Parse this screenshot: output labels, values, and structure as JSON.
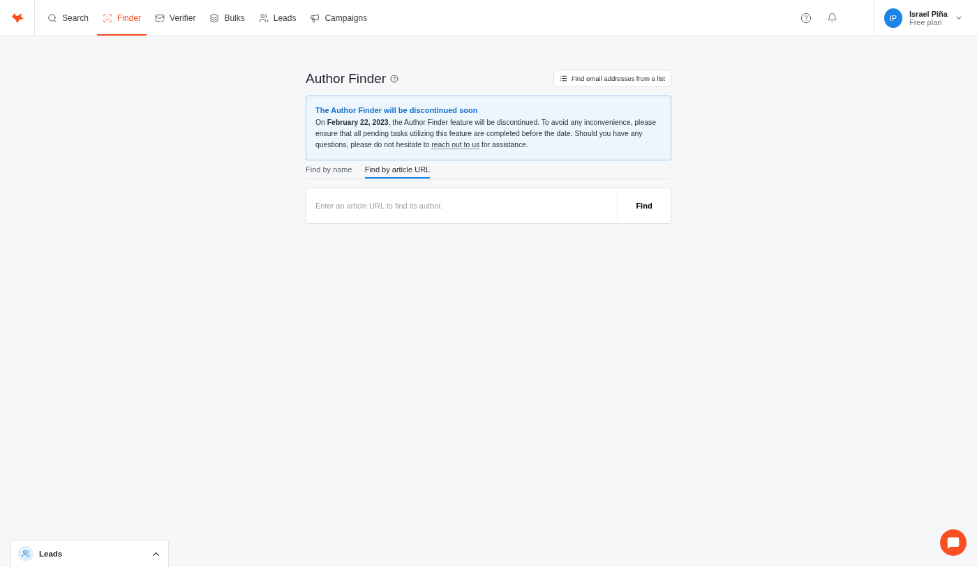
{
  "nav": {
    "items": [
      {
        "label": "Search",
        "selected": false
      },
      {
        "label": "Finder",
        "selected": true
      },
      {
        "label": "Verifier",
        "selected": false
      },
      {
        "label": "Bulks",
        "selected": false
      },
      {
        "label": "Leads",
        "selected": false
      },
      {
        "label": "Campaigns",
        "selected": false
      }
    ]
  },
  "user": {
    "initials": "IP",
    "name": "Israel Piña",
    "plan": "Free plan"
  },
  "page": {
    "title": "Author Finder",
    "list_button": "Find email addresses from a list"
  },
  "notice": {
    "title": "The Author Finder will be discontinued soon",
    "text_before": "On **February 22, 2023**, the Author Finder feature will be discontinued. To avoid any inconvenience, please ensure that all pending tasks utilizing this feature are completed before the date. Should you have any questions, please do not hesitate to ",
    "link": "reach out to us",
    "text_after": " for assistance."
  },
  "tabs": [
    {
      "label": "Find by name",
      "selected": false
    },
    {
      "label": "Find by article URL",
      "selected": true
    }
  ],
  "search": {
    "placeholder": "Enter an article URL to find its author.",
    "button": "Find"
  },
  "leads_widget": {
    "label": "Leads"
  }
}
